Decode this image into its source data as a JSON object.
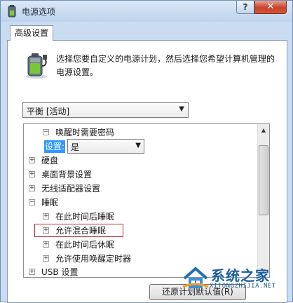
{
  "window": {
    "title": "电源选项",
    "help_label": "?",
    "close_label": "✕"
  },
  "tab": {
    "label": "高级设置"
  },
  "description": "选择您要自定义的电源计划，然后选择您希望计算机管理的电源设置。",
  "plan_select": {
    "value": "平衡 [活动]"
  },
  "tree": {
    "items": [
      {
        "label": "唤醒时需要密码",
        "expander": "−"
      },
      {
        "label": "硬盘",
        "expander": "+"
      },
      {
        "label": "桌面背景设置",
        "expander": "+"
      },
      {
        "label": "无线适配器设置",
        "expander": "+"
      },
      {
        "label": "睡眠",
        "expander": "−"
      },
      {
        "label": "在此时间后睡眠",
        "expander": "+"
      },
      {
        "label": "允许混合睡眠",
        "expander": "+"
      },
      {
        "label": "在此时间后休眠",
        "expander": "+"
      },
      {
        "label": "允许使用唤醒定时器",
        "expander": "+"
      },
      {
        "label": "USB 设置",
        "expander": "+"
      }
    ],
    "setting_label": "设置:",
    "setting_value": "是"
  },
  "restore_button": "还原计划默认值(R)",
  "watermark": {
    "text": "系统之家",
    "url": "XITONGZHIJIA.NET"
  },
  "colors": {
    "selection": "#3399ff",
    "highlight_border": "#c0282d",
    "close_button": "#c9412b"
  }
}
